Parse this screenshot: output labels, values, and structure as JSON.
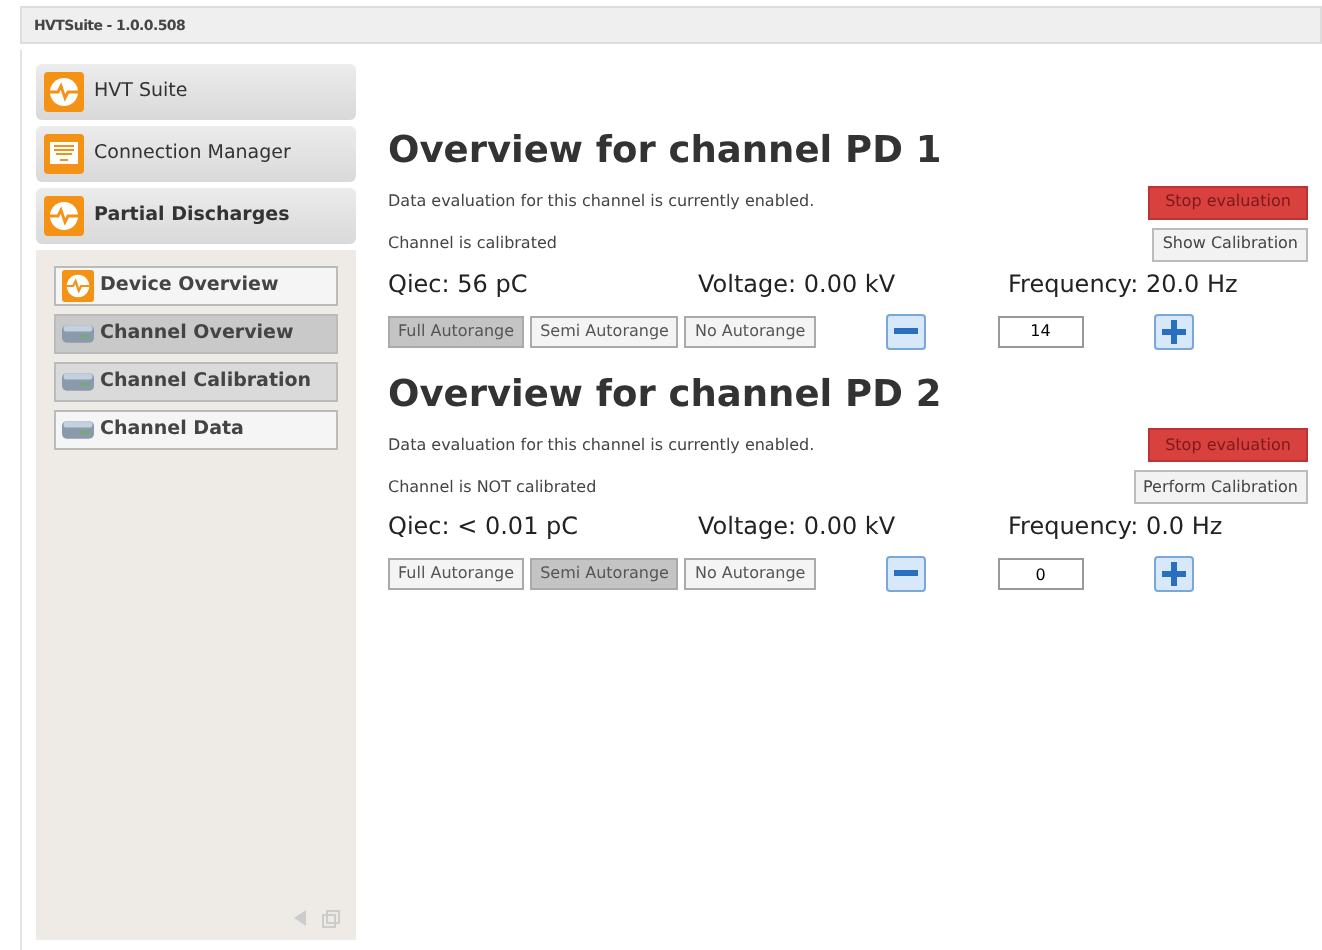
{
  "window": {
    "title": "HVTSuite - 1.0.0.508"
  },
  "sidebar": {
    "items": [
      {
        "label": "HVT Suite",
        "kind": "pulse",
        "selected": false
      },
      {
        "label": "Connection Manager",
        "kind": "network",
        "selected": false
      },
      {
        "label": "Partial Discharges",
        "kind": "pulse",
        "selected": true,
        "children": [
          {
            "label": "Device Overview",
            "kind": "pulse",
            "selected": false,
            "highlighted": false
          },
          {
            "label": "Channel Overview",
            "kind": "device",
            "selected": true,
            "highlighted": false
          },
          {
            "label": "Channel Calibration",
            "kind": "device",
            "selected": false,
            "highlighted": true
          },
          {
            "label": "Channel Data",
            "kind": "device",
            "selected": false,
            "highlighted": false
          }
        ]
      }
    ]
  },
  "channels": [
    {
      "title": "Overview for channel PD 1",
      "evaluation_text": "Data evaluation for this channel is currently enabled.",
      "evaluation_button": "Stop evaluation",
      "calibration_text": "Channel is calibrated",
      "calibration_button": "Show Calibration",
      "qiec": "Qiec: 56 pC",
      "voltage": "Voltage: 0.00 kV",
      "frequency": "Frequency: 20.0 Hz",
      "autorange": [
        {
          "label": "Full Autorange",
          "selected": true
        },
        {
          "label": "Semi Autorange",
          "selected": false
        },
        {
          "label": "No Autorange",
          "selected": false
        }
      ],
      "value": "14"
    },
    {
      "title": "Overview for channel PD 2",
      "evaluation_text": "Data evaluation for this channel is currently enabled.",
      "evaluation_button": "Stop evaluation",
      "calibration_text": "Channel is NOT calibrated",
      "calibration_button": "Perform Calibration",
      "qiec": "Qiec: < 0.01 pC",
      "voltage": "Voltage: 0.00 kV",
      "frequency": "Frequency: 0.0 Hz",
      "autorange": [
        {
          "label": "Full Autorange",
          "selected": false
        },
        {
          "label": "Semi Autorange",
          "selected": true
        },
        {
          "label": "No Autorange",
          "selected": false
        }
      ],
      "value": "0"
    }
  ]
}
